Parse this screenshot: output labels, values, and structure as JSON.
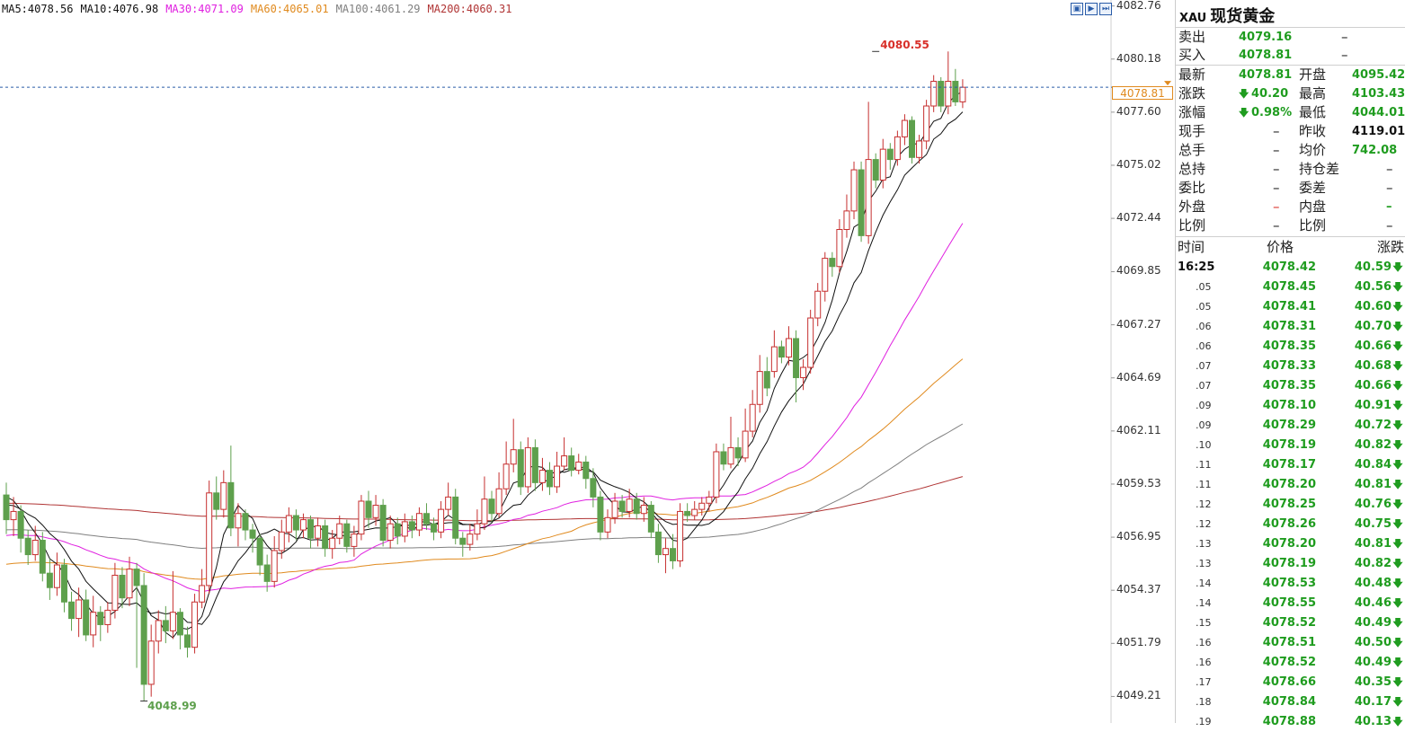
{
  "colors": {
    "up": "#c62f2f",
    "down": "#5ea04d",
    "ma5": "#111111",
    "ma10": "#111111",
    "ma30": "#e020e0",
    "ma60": "#e08a1e",
    "ma100": "#7f7f7f",
    "ma200": "#b03434",
    "current_line": "#2a5ca8"
  },
  "ma_legend": [
    {
      "label": "MA5:4078.56",
      "color": "#111111"
    },
    {
      "label": "MA10:4076.98",
      "color": "#111111"
    },
    {
      "label": "MA30:4071.09",
      "color": "#e020e0"
    },
    {
      "label": "MA60:4065.01",
      "color": "#e08a1e"
    },
    {
      "label": "MA100:4061.29",
      "color": "#7f7f7f"
    },
    {
      "label": "MA200:4060.31",
      "color": "#b03434"
    }
  ],
  "toolbar": {
    "icons": [
      "chart-zoom-icon",
      "chart-play-icon",
      "chart-next-icon"
    ]
  },
  "current_price_tag": "4078.81",
  "high_label": "4080.55",
  "low_label": "4048.99",
  "chart_data": {
    "type": "candlestick",
    "y_axis": {
      "min": 4047.92,
      "max": 4083.05,
      "ticks": [
        "4082.76",
        "4080.18",
        "4077.60",
        "4075.02",
        "4072.44",
        "4069.85",
        "4067.27",
        "4064.69",
        "4062.11",
        "4059.53",
        "4056.95",
        "4054.37",
        "4051.79",
        "4049.21"
      ]
    },
    "current_price": 4078.81,
    "high": {
      "value": 4080.55,
      "index": 120
    },
    "low": {
      "value": 4048.99,
      "index": 19
    },
    "candles": [
      [
        4059.0,
        4057.8,
        4059.6,
        4057.1
      ],
      [
        4057.8,
        4058.2,
        4058.9,
        4057.0
      ],
      [
        4058.2,
        4056.9,
        4058.5,
        4056.2
      ],
      [
        4056.9,
        4056.1,
        4057.3,
        4055.6
      ],
      [
        4056.1,
        4056.8,
        4057.5,
        4055.8
      ],
      [
        4056.8,
        4055.2,
        4057.2,
        4054.8
      ],
      [
        4055.2,
        4054.5,
        4055.9,
        4053.9
      ],
      [
        4054.5,
        4055.6,
        4056.2,
        4054.1
      ],
      [
        4055.6,
        4053.8,
        4055.9,
        4053.3
      ],
      [
        4053.8,
        4053.0,
        4054.3,
        4052.4
      ],
      [
        4053.0,
        4053.9,
        4054.5,
        4052.1
      ],
      [
        4053.9,
        4052.2,
        4054.4,
        4051.9
      ],
      [
        4052.2,
        4053.3,
        4054.1,
        4051.6
      ],
      [
        4053.3,
        4052.7,
        4053.6,
        4051.9
      ],
      [
        4052.7,
        4053.4,
        4053.8,
        4052.3
      ],
      [
        4053.4,
        4055.1,
        4055.7,
        4053.0
      ],
      [
        4055.1,
        4054.0,
        4055.5,
        4053.5
      ],
      [
        4054.0,
        4055.4,
        4056.0,
        4053.6
      ],
      [
        4055.4,
        4054.6,
        4055.7,
        4050.6
      ],
      [
        4054.6,
        4049.8,
        4055.2,
        4048.99
      ],
      [
        4049.8,
        4051.9,
        4052.7,
        4049.2
      ],
      [
        4051.9,
        4052.9,
        4053.4,
        4051.3
      ],
      [
        4052.9,
        4052.4,
        4053.6,
        4051.8
      ],
      [
        4052.4,
        4053.3,
        4055.3,
        4052.0
      ],
      [
        4053.3,
        4052.2,
        4053.5,
        4051.5
      ],
      [
        4052.2,
        4051.6,
        4052.6,
        4051.1
      ],
      [
        4051.6,
        4053.8,
        4054.2,
        4051.3
      ],
      [
        4053.8,
        4054.6,
        4055.4,
        4053.5
      ],
      [
        4054.6,
        4059.1,
        4059.7,
        4054.2
      ],
      [
        4059.1,
        4058.3,
        4059.9,
        4057.8
      ],
      [
        4058.3,
        4059.6,
        4060.2,
        4057.9
      ],
      [
        4059.6,
        4057.4,
        4061.4,
        4057.0
      ],
      [
        4057.4,
        4058.1,
        4058.6,
        4056.5
      ],
      [
        4058.1,
        4057.3,
        4058.3,
        4056.8
      ],
      [
        4057.3,
        4056.9,
        4057.6,
        4056.2
      ],
      [
        4056.9,
        4055.6,
        4057.1,
        4055.1
      ],
      [
        4055.6,
        4054.8,
        4056.1,
        4054.3
      ],
      [
        4054.8,
        4056.3,
        4057.0,
        4054.5
      ],
      [
        4056.3,
        4057.2,
        4057.8,
        4055.9
      ],
      [
        4057.2,
        4058.0,
        4058.4,
        4056.7
      ],
      [
        4058.0,
        4057.3,
        4058.3,
        4056.8
      ],
      [
        4057.3,
        4057.8,
        4058.1,
        4056.9
      ],
      [
        4057.8,
        4056.9,
        4058.0,
        4056.4
      ],
      [
        4056.9,
        4057.5,
        4057.9,
        4056.5
      ],
      [
        4057.5,
        4056.4,
        4057.8,
        4056.0
      ],
      [
        4056.4,
        4056.9,
        4057.3,
        4055.9
      ],
      [
        4056.9,
        4057.6,
        4058.0,
        4056.6
      ],
      [
        4057.6,
        4056.5,
        4057.8,
        4056.2
      ],
      [
        4056.5,
        4057.1,
        4057.5,
        4056.0
      ],
      [
        4057.1,
        4058.7,
        4059.0,
        4056.8
      ],
      [
        4058.7,
        4057.9,
        4059.2,
        4057.4
      ],
      [
        4057.9,
        4058.5,
        4059.0,
        4057.5
      ],
      [
        4058.5,
        4056.8,
        4058.8,
        4056.5
      ],
      [
        4056.8,
        4057.6,
        4058.0,
        4056.4
      ],
      [
        4057.6,
        4057.0,
        4057.9,
        4056.6
      ],
      [
        4057.0,
        4057.7,
        4058.1,
        4056.7
      ],
      [
        4057.7,
        4057.3,
        4058.0,
        4056.9
      ],
      [
        4057.3,
        4058.1,
        4058.4,
        4057.0
      ],
      [
        4058.1,
        4057.6,
        4058.6,
        4057.3
      ],
      [
        4057.6,
        4057.2,
        4057.9,
        4056.8
      ],
      [
        4057.2,
        4058.3,
        4058.7,
        4056.9
      ],
      [
        4058.3,
        4058.9,
        4059.6,
        4058.0
      ],
      [
        4058.9,
        4056.9,
        4059.3,
        4056.6
      ],
      [
        4056.9,
        4056.6,
        4057.2,
        4056.0
      ],
      [
        4056.6,
        4057.1,
        4057.6,
        4056.3
      ],
      [
        4057.1,
        4057.6,
        4058.3,
        4056.8
      ],
      [
        4057.6,
        4058.8,
        4059.9,
        4057.3
      ],
      [
        4058.8,
        4058.1,
        4059.2,
        4057.7
      ],
      [
        4058.1,
        4059.3,
        4060.1,
        4057.9
      ],
      [
        4059.3,
        4060.5,
        4061.6,
        4059.0
      ],
      [
        4060.5,
        4061.2,
        4062.7,
        4060.1
      ],
      [
        4061.2,
        4059.4,
        4061.6,
        4059.0
      ],
      [
        4059.4,
        4061.3,
        4061.8,
        4059.1
      ],
      [
        4061.3,
        4059.6,
        4061.7,
        4059.2
      ],
      [
        4059.6,
        4060.2,
        4060.8,
        4059.2
      ],
      [
        4060.2,
        4059.4,
        4060.6,
        4059.0
      ],
      [
        4059.4,
        4060.4,
        4061.1,
        4059.1
      ],
      [
        4060.4,
        4060.9,
        4061.8,
        4060.2
      ],
      [
        4060.9,
        4060.2,
        4061.3,
        4059.9
      ],
      [
        4060.2,
        4060.6,
        4061.0,
        4060.0
      ],
      [
        4060.6,
        4059.8,
        4060.9,
        4059.3
      ],
      [
        4059.8,
        4058.9,
        4060.3,
        4058.4
      ],
      [
        4058.9,
        4057.2,
        4059.2,
        4056.8
      ],
      [
        4057.2,
        4057.9,
        4058.3,
        4056.9
      ],
      [
        4057.9,
        4058.7,
        4059.1,
        4057.6
      ],
      [
        4058.7,
        4058.2,
        4059.0,
        4057.9
      ],
      [
        4058.2,
        4058.8,
        4059.3,
        4057.9
      ],
      [
        4058.8,
        4058.1,
        4059.1,
        4057.8
      ],
      [
        4058.1,
        4058.5,
        4058.9,
        4057.7
      ],
      [
        4058.5,
        4057.2,
        4058.7,
        4056.9
      ],
      [
        4057.2,
        4056.1,
        4057.6,
        4055.7
      ],
      [
        4056.1,
        4056.4,
        4056.9,
        4055.2
      ],
      [
        4056.4,
        4055.8,
        4057.1,
        4055.4
      ],
      [
        4055.8,
        4058.2,
        4058.6,
        4055.5
      ],
      [
        4058.2,
        4058.0,
        4058.6,
        4057.7
      ],
      [
        4058.0,
        4058.3,
        4058.7,
        4057.8
      ],
      [
        4058.3,
        4058.6,
        4058.9,
        4058.0
      ],
      [
        4058.6,
        4058.9,
        4059.2,
        4058.2
      ],
      [
        4058.9,
        4061.1,
        4061.5,
        4058.6
      ],
      [
        4061.1,
        4060.5,
        4061.5,
        4060.2
      ],
      [
        4060.5,
        4061.3,
        4062.8,
        4060.3
      ],
      [
        4061.3,
        4060.8,
        4061.8,
        4060.4
      ],
      [
        4060.8,
        4062.1,
        4063.2,
        4060.6
      ],
      [
        4062.1,
        4063.4,
        4064.1,
        4061.8
      ],
      [
        4063.4,
        4065.0,
        4065.8,
        4063.0
      ],
      [
        4065.0,
        4064.2,
        4065.7,
        4063.8
      ],
      [
        4065.0,
        4066.2,
        4067.0,
        4064.7
      ],
      [
        4066.2,
        4065.7,
        4066.5,
        4065.4
      ],
      [
        4065.7,
        4066.6,
        4067.2,
        4065.3
      ],
      [
        4066.6,
        4064.7,
        4067.0,
        4063.5
      ],
      [
        4064.7,
        4065.2,
        4065.6,
        4064.1
      ],
      [
        4065.2,
        4067.6,
        4068.0,
        4064.9
      ],
      [
        4067.6,
        4068.9,
        4069.3,
        4067.2
      ],
      [
        4068.9,
        4070.5,
        4070.8,
        4068.4
      ],
      [
        4070.5,
        4070.1,
        4070.8,
        4069.6
      ],
      [
        4070.1,
        4071.9,
        4072.4,
        4069.8
      ],
      [
        4071.9,
        4072.8,
        4073.6,
        4071.5
      ],
      [
        4072.8,
        4074.8,
        4075.2,
        4072.4
      ],
      [
        4074.8,
        4071.6,
        4075.2,
        4071.3
      ],
      [
        4071.6,
        4075.3,
        4078.1,
        4071.2
      ],
      [
        4075.3,
        4074.3,
        4075.6,
        4073.9
      ],
      [
        4074.3,
        4075.8,
        4076.3,
        4073.9
      ],
      [
        4075.8,
        4075.3,
        4076.1,
        4074.8
      ],
      [
        4075.3,
        4076.4,
        4076.7,
        4075.0
      ],
      [
        4076.4,
        4077.2,
        4077.5,
        4076.0
      ],
      [
        4077.2,
        4075.4,
        4077.4,
        4075.1
      ],
      [
        4075.4,
        4076.2,
        4076.5,
        4075.1
      ],
      [
        4076.2,
        4077.9,
        4078.2,
        4075.8
      ],
      [
        4077.9,
        4079.1,
        4079.4,
        4077.6
      ],
      [
        4079.1,
        4077.9,
        4079.3,
        4077.6
      ],
      [
        4077.9,
        4079.1,
        4080.55,
        4077.5
      ],
      [
        4079.1,
        4078.1,
        4079.7,
        4077.9
      ],
      [
        4078.1,
        4078.81,
        4079.2,
        4077.8
      ]
    ]
  },
  "panel": {
    "symbol": "XAU",
    "name": "现货黄金",
    "bid_ask": [
      {
        "label": "卖出",
        "value": "4079.16",
        "vol": "–"
      },
      {
        "label": "买入",
        "value": "4078.81",
        "vol": "–"
      }
    ],
    "quote": [
      {
        "l1": "最新",
        "v1": "4078.81",
        "l2": "开盘",
        "v2": "4095.42"
      },
      {
        "l1": "涨跌",
        "v1": "40.20",
        "arrow1": true,
        "l2": "最高",
        "v2": "4103.43"
      },
      {
        "l1": "涨幅",
        "v1": "0.98%",
        "arrow1": true,
        "l2": "最低",
        "v2": "4044.01"
      },
      {
        "l1": "现手",
        "v1": "–",
        "l2": "昨收",
        "v2": "4119.01",
        "v2black": true
      },
      {
        "l1": "总手",
        "v1": "–",
        "l2": "均价",
        "v2": "742.08"
      },
      {
        "l1": "总持",
        "v1": "–",
        "l2": "持仓差",
        "v2": "–"
      },
      {
        "l1": "委比",
        "v1": "–",
        "l2": "委差",
        "v2": "–"
      },
      {
        "l1": "外盘",
        "v1": "–",
        "v1red": true,
        "l2": "内盘",
        "v2": "–"
      },
      {
        "l1": "比例",
        "v1": "–",
        "l2": "比例",
        "v2": "–"
      }
    ],
    "ticks_header": {
      "time": "时间",
      "price": "价格",
      "change": "涨跌"
    },
    "ticks": [
      {
        "time": "16:25",
        "price": "4078.42",
        "change": "40.59"
      },
      {
        "time": ".05",
        "price": "4078.45",
        "change": "40.56"
      },
      {
        "time": ".05",
        "price": "4078.41",
        "change": "40.60"
      },
      {
        "time": ".06",
        "price": "4078.31",
        "change": "40.70"
      },
      {
        "time": ".06",
        "price": "4078.35",
        "change": "40.66"
      },
      {
        "time": ".07",
        "price": "4078.33",
        "change": "40.68"
      },
      {
        "time": ".07",
        "price": "4078.35",
        "change": "40.66"
      },
      {
        "time": ".09",
        "price": "4078.10",
        "change": "40.91"
      },
      {
        "time": ".09",
        "price": "4078.29",
        "change": "40.72"
      },
      {
        "time": ".10",
        "price": "4078.19",
        "change": "40.82"
      },
      {
        "time": ".11",
        "price": "4078.17",
        "change": "40.84"
      },
      {
        "time": ".11",
        "price": "4078.20",
        "change": "40.81"
      },
      {
        "time": ".12",
        "price": "4078.25",
        "change": "40.76"
      },
      {
        "time": ".12",
        "price": "4078.26",
        "change": "40.75"
      },
      {
        "time": ".13",
        "price": "4078.20",
        "change": "40.81"
      },
      {
        "time": ".13",
        "price": "4078.19",
        "change": "40.82"
      },
      {
        "time": ".14",
        "price": "4078.53",
        "change": "40.48"
      },
      {
        "time": ".14",
        "price": "4078.55",
        "change": "40.46"
      },
      {
        "time": ".15",
        "price": "4078.52",
        "change": "40.49"
      },
      {
        "time": ".16",
        "price": "4078.51",
        "change": "40.50"
      },
      {
        "time": ".16",
        "price": "4078.52",
        "change": "40.49"
      },
      {
        "time": ".17",
        "price": "4078.66",
        "change": "40.35"
      },
      {
        "time": ".18",
        "price": "4078.84",
        "change": "40.17"
      },
      {
        "time": ".19",
        "price": "4078.88",
        "change": "40.13"
      }
    ]
  }
}
